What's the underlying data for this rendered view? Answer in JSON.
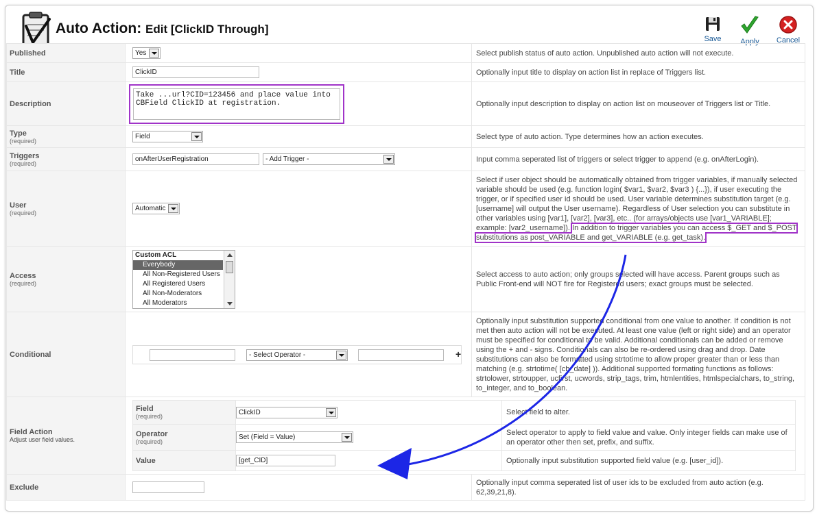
{
  "header": {
    "title": "Auto Action:",
    "subtitle": "Edit [ClickID Through]"
  },
  "toolbar": {
    "save_label": "Save",
    "apply_label": "Apply",
    "cancel_label": "Cancel"
  },
  "colors": {
    "highlight": "#a033c8",
    "arrow": "#1c26e6",
    "apply_green": "#2ea52e",
    "cancel_red": "#d42020"
  },
  "rows": {
    "published": {
      "label": "Published",
      "value": "Yes",
      "help": "Select publish status of auto action. Unpublished auto action will not execute."
    },
    "title": {
      "label": "Title",
      "value": "ClickID",
      "help": "Optionally input title to display on action list in replace of Triggers list."
    },
    "description": {
      "label": "Description",
      "value": "Take ...url?CID=123456 and place value into CBField ClickID at registration.",
      "help": "Optionally input description to display on action list on mouseover of Triggers list or Title."
    },
    "type": {
      "label": "Type",
      "required": "(required)",
      "value": "Field",
      "help": "Select type of auto action. Type determines how an action executes."
    },
    "triggers": {
      "label": "Triggers",
      "required": "(required)",
      "value": "onAfterUserRegistration",
      "select": "- Add Trigger -",
      "help": "Input comma seperated list of triggers or select trigger to append (e.g. onAfterLogin)."
    },
    "user": {
      "label": "User",
      "required": "(required)",
      "value": "Automatic",
      "help": "Select if user object should be automatically obtained from trigger variables, if manually selected variable should be used (e.g. function login( $var1, $var2, $var3 ) {...}), if user executing the trigger, or if specified user id should be used. User variable determines substitution target (e.g. [username] will output the User username). Regardless of User selection you can substitute in other variables using [var1], [var2], [var3], etc.. (for arrays/objects use [var1_VARIABLE]; example: [var2_username]).",
      "help_highlight": "In addition to trigger variables you can access $_GET and $_POST substitutions as post_VARIABLE and get_VARIABLE (e.g. get_task)."
    },
    "access": {
      "label": "Access",
      "required": "(required)",
      "options": [
        "Custom ACL",
        "Everybody",
        "All Non-Registered Users",
        "All Registered Users",
        "All Non-Moderators",
        "All Moderators"
      ],
      "help": "Select access to auto action; only groups selected will have access. Parent groups such as Public Front-end will NOT fire for Registered users; exact groups must be selected."
    },
    "conditional": {
      "label": "Conditional",
      "operator": "- Select Operator -",
      "add": "+",
      "help": "Optionally input substitution supported conditional from one value to another. If condition is not met then auto action will not be executed. At least one value (left or right side) and an operator must be specified for conditional to be valid. Additional conditionals can be added or remove using the + and - signs. Conditionals can also be re-ordered using drag and drop. Date substitutions can also be formatted using strtotime to allow proper greater than or less than matching (e.g. strtotime( [cb_date] )). Additional supported formating functions as follows: strtolower, strtoupper, ucfirst, ucwords, strip_tags, trim, htmlentities, htmlspecialchars, to_string, to_integer, and to_boolean."
    },
    "field_action": {
      "label": "Field Action",
      "note": "Adjust user field values.",
      "field": {
        "label": "Field",
        "required": "(required)",
        "value": "ClickID",
        "help": "Select field to alter."
      },
      "operator": {
        "label": "Operator",
        "required": "(required)",
        "value": "Set (Field = Value)",
        "help": "Select operator to apply to field value and value. Only integer fields can make use of an operator other then set, prefix, and suffix."
      },
      "value": {
        "label": "Value",
        "value": "[get_CID]",
        "help": "Optionally input substitution supported field value (e.g. [user_id])."
      }
    },
    "exclude": {
      "label": "Exclude",
      "value": "",
      "help": "Optionally input comma seperated list of user ids to be excluded from auto action (e.g. 62,39,21,8)."
    }
  }
}
